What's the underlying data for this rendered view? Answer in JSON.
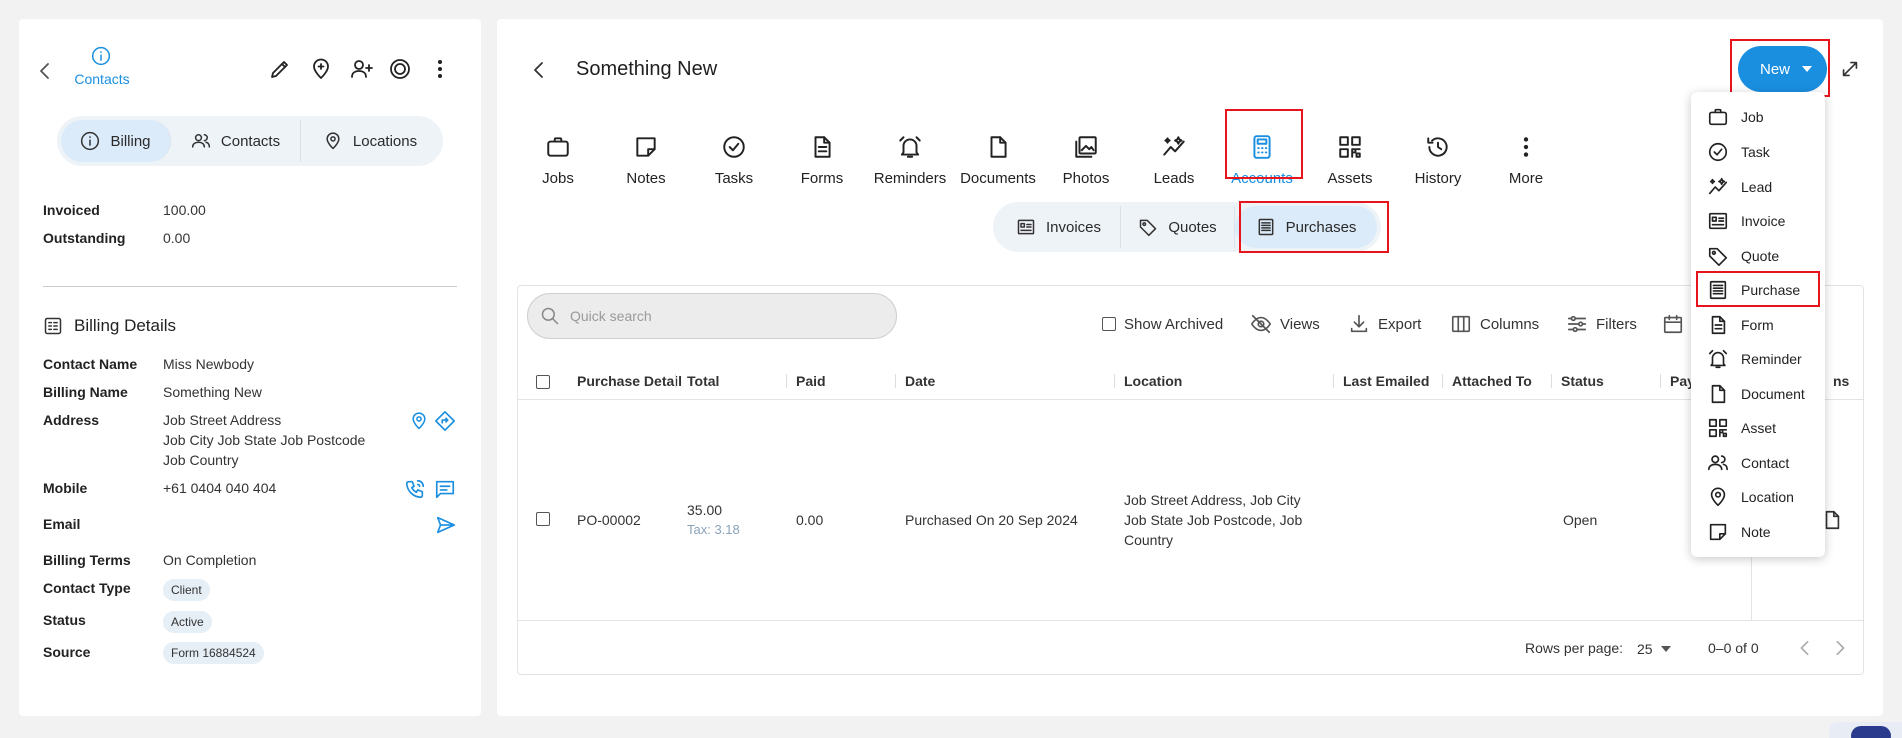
{
  "colors": {
    "accent": "#1a8fe0",
    "highlight": "#e8141b"
  },
  "left": {
    "header_label": "Contacts",
    "segments": [
      {
        "label": "Billing",
        "icon": "info-icon"
      },
      {
        "label": "Contacts",
        "icon": "people-icon"
      },
      {
        "label": "Locations",
        "icon": "location-icon"
      }
    ],
    "invoiced_label": "Invoiced",
    "invoiced_value": "100.00",
    "outstanding_label": "Outstanding",
    "outstanding_value": "0.00",
    "billing_details_title": "Billing Details",
    "contact_name_label": "Contact Name",
    "contact_name": "Miss Newbody",
    "billing_name_label": "Billing Name",
    "billing_name": "Something New",
    "address_label": "Address",
    "address_line1": "Job Street Address",
    "address_line2": "Job City Job State Job Postcode",
    "address_line3": "Job Country",
    "mobile_label": "Mobile",
    "mobile": "+61 0404 040 404",
    "email_label": "Email",
    "billing_terms_label": "Billing Terms",
    "billing_terms": "On Completion",
    "contact_type_label": "Contact Type",
    "contact_type": "Client",
    "status_label": "Status",
    "status": "Active",
    "source_label": "Source",
    "source": "Form 16884524"
  },
  "main": {
    "title": "Something New",
    "new_button": "New",
    "tabs": [
      {
        "label": "Jobs",
        "icon": "briefcase-icon"
      },
      {
        "label": "Notes",
        "icon": "note-icon"
      },
      {
        "label": "Tasks",
        "icon": "check-circle-icon"
      },
      {
        "label": "Forms",
        "icon": "form-icon"
      },
      {
        "label": "Reminders",
        "icon": "alarm-icon"
      },
      {
        "label": "Documents",
        "icon": "document-icon"
      },
      {
        "label": "Photos",
        "icon": "photos-icon"
      },
      {
        "label": "Leads",
        "icon": "sparkle-icon"
      },
      {
        "label": "Accounts",
        "icon": "calculator-icon"
      },
      {
        "label": "Assets",
        "icon": "qr-icon"
      },
      {
        "label": "History",
        "icon": "history-icon"
      },
      {
        "label": "More",
        "icon": "more-vertical-icon"
      }
    ],
    "subtabs": [
      {
        "label": "Invoices",
        "icon": "invoice-icon"
      },
      {
        "label": "Quotes",
        "icon": "tag-icon"
      },
      {
        "label": "Purchases",
        "icon": "list-doc-icon"
      }
    ],
    "search_placeholder": "Quick search",
    "toolbar": {
      "show_archived": "Show Archived",
      "views": "Views",
      "export": "Export",
      "columns": "Columns",
      "filters": "Filters"
    },
    "columns": [
      "Purchase Detail",
      "Total",
      "Paid",
      "Date",
      "Location",
      "Last Emailed",
      "Attached To",
      "Status",
      "Pay",
      "ns"
    ],
    "row": {
      "id": "PO-00002",
      "total": "35.00",
      "tax": "Tax: 3.18",
      "paid": "0.00",
      "date": "Purchased On 20 Sep 2024",
      "location_line1": "Job Street Address, Job City",
      "location_line2": "Job State Job Postcode, Job",
      "location_line3": "Country",
      "status": "Open"
    },
    "footer": {
      "rows_per_page_label": "Rows per page:",
      "rows_per_page": "25",
      "range": "0–0 of 0"
    }
  },
  "new_menu": [
    {
      "label": "Job",
      "icon": "briefcase-icon"
    },
    {
      "label": "Task",
      "icon": "check-circle-icon"
    },
    {
      "label": "Lead",
      "icon": "sparkle-icon"
    },
    {
      "label": "Invoice",
      "icon": "invoice-icon"
    },
    {
      "label": "Quote",
      "icon": "tag-icon"
    },
    {
      "label": "Purchase",
      "icon": "list-doc-icon"
    },
    {
      "label": "Form",
      "icon": "form-icon"
    },
    {
      "label": "Reminder",
      "icon": "alarm-icon"
    },
    {
      "label": "Document",
      "icon": "document-icon"
    },
    {
      "label": "Asset",
      "icon": "qr-icon"
    },
    {
      "label": "Contact",
      "icon": "people-icon"
    },
    {
      "label": "Location",
      "icon": "location-icon"
    },
    {
      "label": "Note",
      "icon": "note-icon"
    }
  ]
}
